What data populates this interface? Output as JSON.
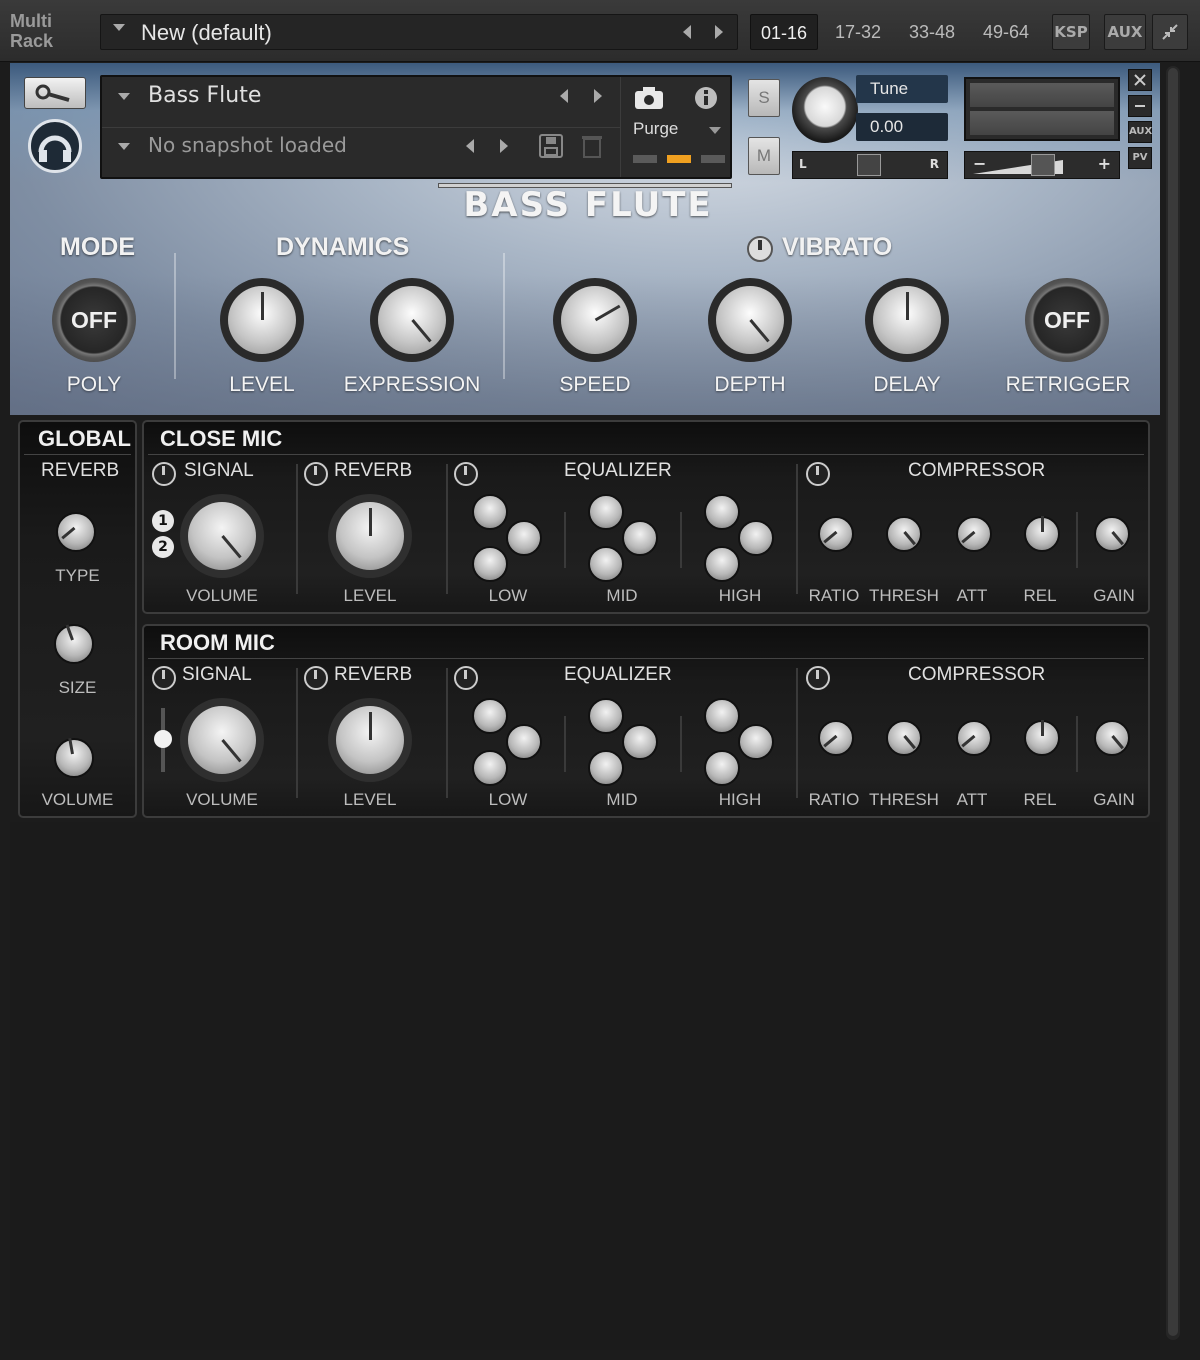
{
  "topbar": {
    "multi_line1": "Multi",
    "multi_line2": "Rack",
    "rack_name": "New (default)",
    "tabs": [
      {
        "label": "01-16",
        "active": true
      },
      {
        "label": "17-32",
        "active": false
      },
      {
        "label": "33-48",
        "active": false
      },
      {
        "label": "49-64",
        "active": false
      }
    ],
    "ksp_label": "KSP",
    "aux_label": "AUX"
  },
  "instrument": {
    "name": "Bass Flute",
    "snapshot": "No snapshot loaded",
    "purge_label": "Purge",
    "solo_label": "S",
    "mute_label": "M",
    "tune_label": "Tune",
    "tune_value": "0.00",
    "pan_left": "L",
    "pan_right": "R",
    "vol_minus": "−",
    "vol_plus": "+",
    "side_aux": "AUX",
    "side_pv": "PV",
    "title": "BASS FLUTE",
    "accent_color": "#f0a020"
  },
  "sections": {
    "mode": "MODE",
    "dynamics": "DYNAMICS",
    "vibrato": "VIBRATO"
  },
  "controls": {
    "mode_button": "OFF",
    "mode_label": "POLY",
    "level_label": "LEVEL",
    "expression_label": "EXPRESSION",
    "speed_label": "SPEED",
    "depth_label": "DEPTH",
    "delay_label": "DELAY",
    "retrigger_button": "OFF",
    "retrigger_label": "RETRIGGER"
  },
  "global": {
    "title": "GLOBAL",
    "reverb": "REVERB",
    "type": "TYPE",
    "size": "SIZE",
    "volume": "VOLUME"
  },
  "close_mic": {
    "title": "CLOSE MIC",
    "signal": "SIGNAL",
    "reverb": "REVERB",
    "equalizer": "EQUALIZER",
    "compressor": "COMPRESSOR",
    "volume": "VOLUME",
    "level": "LEVEL",
    "low": "LOW",
    "mid": "MID",
    "high": "HIGH",
    "ratio": "RATIO",
    "thresh": "THRESH",
    "att": "ATT",
    "rel": "REL",
    "gain": "GAIN",
    "badge1": "1",
    "badge2": "2"
  },
  "room_mic": {
    "title": "ROOM MIC",
    "signal": "SIGNAL",
    "reverb": "REVERB",
    "equalizer": "EQUALIZER",
    "compressor": "COMPRESSOR",
    "volume": "VOLUME",
    "level": "LEVEL",
    "low": "LOW",
    "mid": "MID",
    "high": "HIGH",
    "ratio": "RATIO",
    "thresh": "THRESH",
    "att": "ATT",
    "rel": "REL",
    "gain": "GAIN"
  }
}
